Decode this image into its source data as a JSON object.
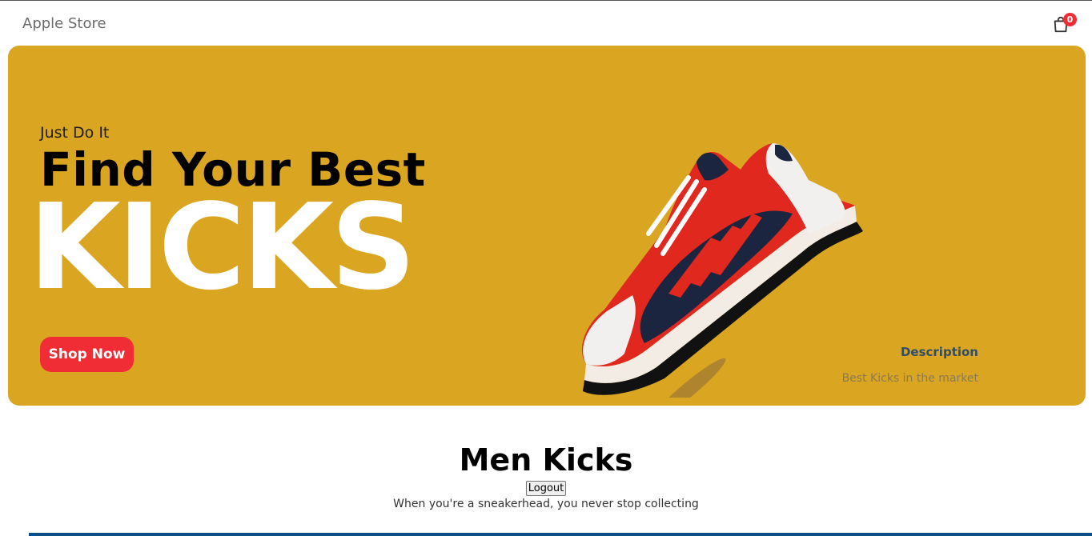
{
  "navbar": {
    "logo": "Apple Store",
    "cart_count": "0"
  },
  "hero": {
    "small_text": "Just Do It",
    "mid_text": "Find Your Best",
    "large_text": "KICKS",
    "button_label": "Shop Now",
    "desc_title": "Description",
    "desc_text": "Best Kicks in the market",
    "image": "red-navy-white-sneaker"
  },
  "products": {
    "title": "Men Kicks",
    "logout_label": "Logout",
    "subtitle": "When you're a sneakerhead, you never stop collecting"
  },
  "colors": {
    "banner": "#daa520",
    "accent": "#f02d34"
  }
}
